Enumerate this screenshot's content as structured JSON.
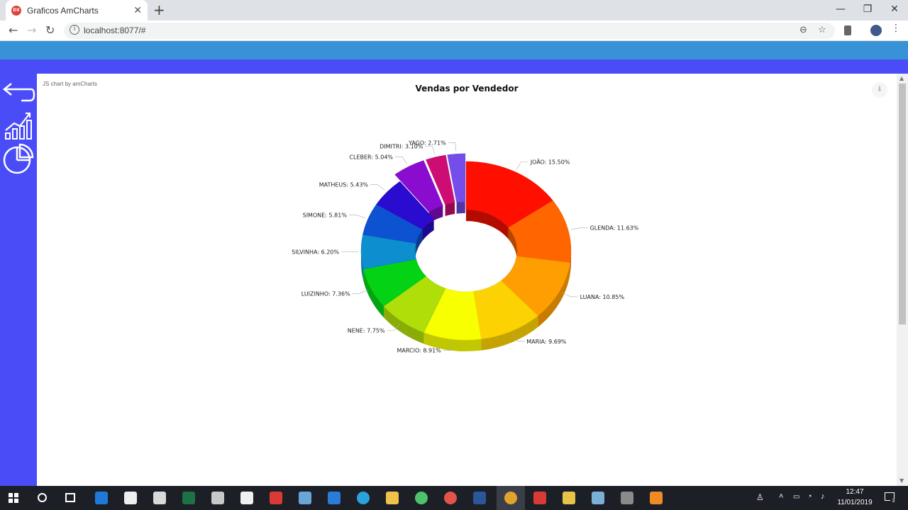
{
  "browser": {
    "tab_title": "Graficos AmCharts",
    "tab_favicon": "DX",
    "url": "localhost:8077/#"
  },
  "colors": {
    "page_top": "#3893d6",
    "sidebar": "#4a4cf8"
  },
  "sidebar": {
    "items": [
      {
        "icon": "back-arrow-icon"
      },
      {
        "icon": "line-chart-icon"
      },
      {
        "icon": "pie-chart-icon"
      }
    ]
  },
  "chart_data": {
    "type": "pie",
    "title": "Vendas por Vendedor",
    "credit": "JS chart by amCharts",
    "donut": true,
    "three_d": true,
    "slices": [
      {
        "name": "JOÃO",
        "value": 15.5,
        "color": "#ff0f00"
      },
      {
        "name": "GLENDA",
        "value": 11.63,
        "color": "#ff6600"
      },
      {
        "name": "LUANA",
        "value": 10.85,
        "color": "#ff9e01"
      },
      {
        "name": "MARIA",
        "value": 9.69,
        "color": "#fcd202"
      },
      {
        "name": "MARCIO",
        "value": 8.91,
        "color": "#f8ff01"
      },
      {
        "name": "NENE",
        "value": 7.75,
        "color": "#b0de09"
      },
      {
        "name": "LUIZINHO",
        "value": 7.36,
        "color": "#04d215"
      },
      {
        "name": "SILVINHA",
        "value": 6.2,
        "color": "#0d8ecf"
      },
      {
        "name": "SIMONE",
        "value": 5.81,
        "color": "#0d52d1"
      },
      {
        "name": "MATHEUS",
        "value": 5.43,
        "color": "#2a0cd0"
      },
      {
        "name": "CLEBER",
        "value": 5.04,
        "color": "#8a0ccf"
      },
      {
        "name": "DIMITRI",
        "value": 3.1,
        "color": "#cd0d74"
      },
      {
        "name": "YAGO",
        "value": 2.71,
        "color": "#754deb"
      }
    ]
  },
  "taskbar": {
    "time": "12:47",
    "date": "11/01/2019",
    "notifications": "3"
  }
}
